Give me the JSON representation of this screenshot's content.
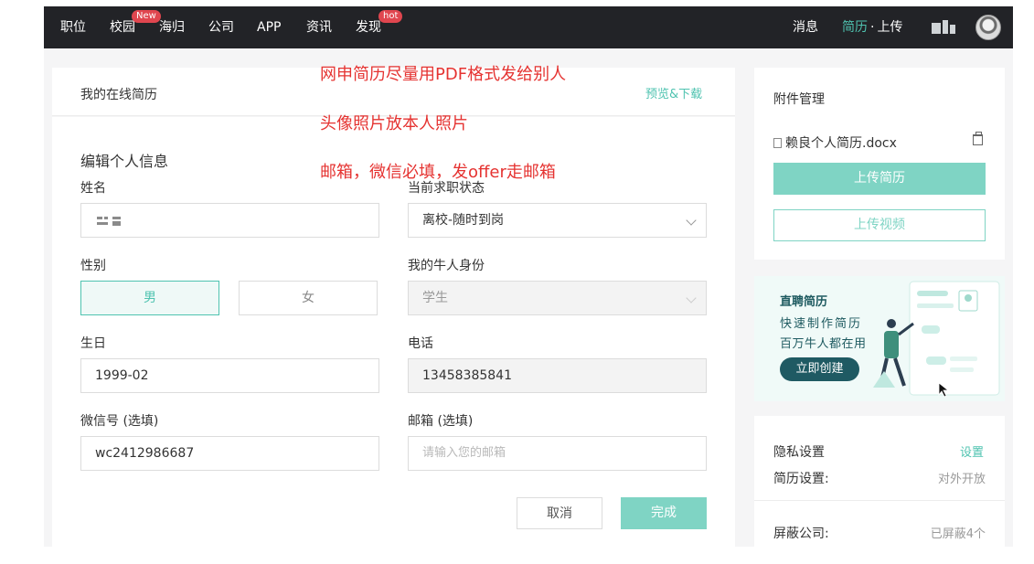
{
  "nav": {
    "items": [
      {
        "label": "职位"
      },
      {
        "label": "校园",
        "badge": "New"
      },
      {
        "label": "海归"
      },
      {
        "label": "公司"
      },
      {
        "label": "APP"
      },
      {
        "label": "资讯"
      },
      {
        "label": "发现",
        "badge": "hot"
      }
    ],
    "messages": "消息",
    "resume": "简历",
    "separator": "·",
    "upload": "上传",
    "colors": {
      "bar": "#222327",
      "accent": "#4fc3b0",
      "badge": "#e0464f"
    }
  },
  "main": {
    "header_title": "我的在线简历",
    "preview_link": "预览&下载",
    "section_title": "编辑个人信息",
    "fields": {
      "name_label": "姓名",
      "name_value": "",
      "job_status_label": "当前求职状态",
      "job_status_value": "离校-随时到岗",
      "gender_label": "性别",
      "gender_male": "男",
      "gender_female": "女",
      "identity_label": "我的牛人身份",
      "identity_value": "学生",
      "birthday_label": "生日",
      "birthday_value": "1999-02",
      "phone_label": "电话",
      "phone_value": "13458385841",
      "wechat_label": "微信号 (选填)",
      "wechat_value": "wc2412986687",
      "email_label": "邮箱 (选填)",
      "email_placeholder": "请输入您的邮箱"
    },
    "cancel_label": "取消",
    "done_label": "完成"
  },
  "notes": [
    "网申简历尽量用PDF格式发给别人",
    "头像照片放本人照片",
    "邮箱，微信必填，发offer走邮箱"
  ],
  "attachments": {
    "title": "附件管理",
    "file_name": "赖良个人简历.docx",
    "upload_resume": "上传简历",
    "upload_video": "上传视频"
  },
  "promo": {
    "title": "直聘简历",
    "line1": "快速制作简历",
    "line2": "百万牛人都在用",
    "button": "立即创建"
  },
  "privacy": {
    "title": "隐私设置",
    "settings_link": "设置",
    "resume_setting_label": "简历设置:",
    "resume_setting_value": "对外开放",
    "blocked_label": "屏蔽公司:",
    "blocked_value": "已屏蔽4个"
  }
}
